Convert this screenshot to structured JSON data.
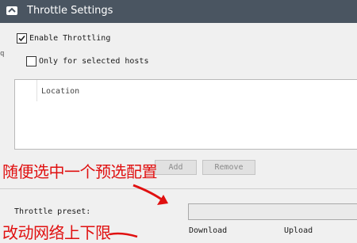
{
  "window": {
    "title": "Throttle Settings"
  },
  "stray_char": "q",
  "options": {
    "enable_throttling": {
      "label": "Enable Throttling",
      "checked": true
    },
    "only_selected_hosts": {
      "label": "Only for selected hosts",
      "checked": false
    }
  },
  "hosts_table": {
    "columns": [
      "Location"
    ]
  },
  "buttons": {
    "add": "Add",
    "remove": "Remove"
  },
  "preset": {
    "label": "Throttle preset:",
    "value": ""
  },
  "rates": {
    "download_label": "Download",
    "upload_label": "Upload"
  },
  "annotations": {
    "text1": "随便选中一个预选配置",
    "text2": "改动网络上下限",
    "color": "#e01010"
  },
  "icons": {
    "app": "network-gear-icon",
    "check": "checkmark-icon",
    "arrow": "red-arrow-icon"
  }
}
